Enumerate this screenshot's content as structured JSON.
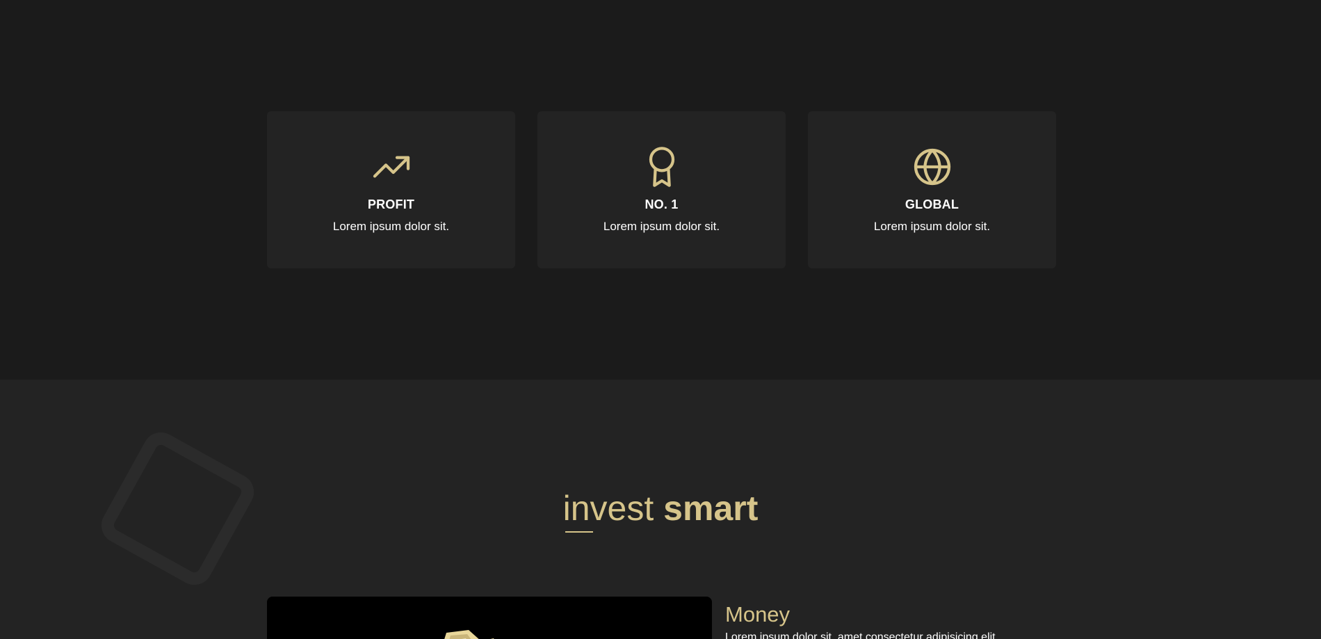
{
  "features": [
    {
      "icon": "trending-up-icon",
      "title": "PROFIT",
      "description": "Lorem ipsum dolor sit."
    },
    {
      "icon": "award-icon",
      "title": "NO. 1",
      "description": "Lorem ipsum dolor sit."
    },
    {
      "icon": "globe-icon",
      "title": "GLOBAL",
      "description": "Lorem ipsum dolor sit."
    }
  ],
  "invest": {
    "heading_light": "invest",
    "heading_bold": "smart"
  },
  "money": {
    "title": "Money",
    "text": "Lorem ipsum dolor sit, amet consectetur adipisicing elit."
  },
  "colors": {
    "accent": "#d6c48a",
    "background_dark": "#1b1b1b",
    "background_card": "#232323"
  }
}
